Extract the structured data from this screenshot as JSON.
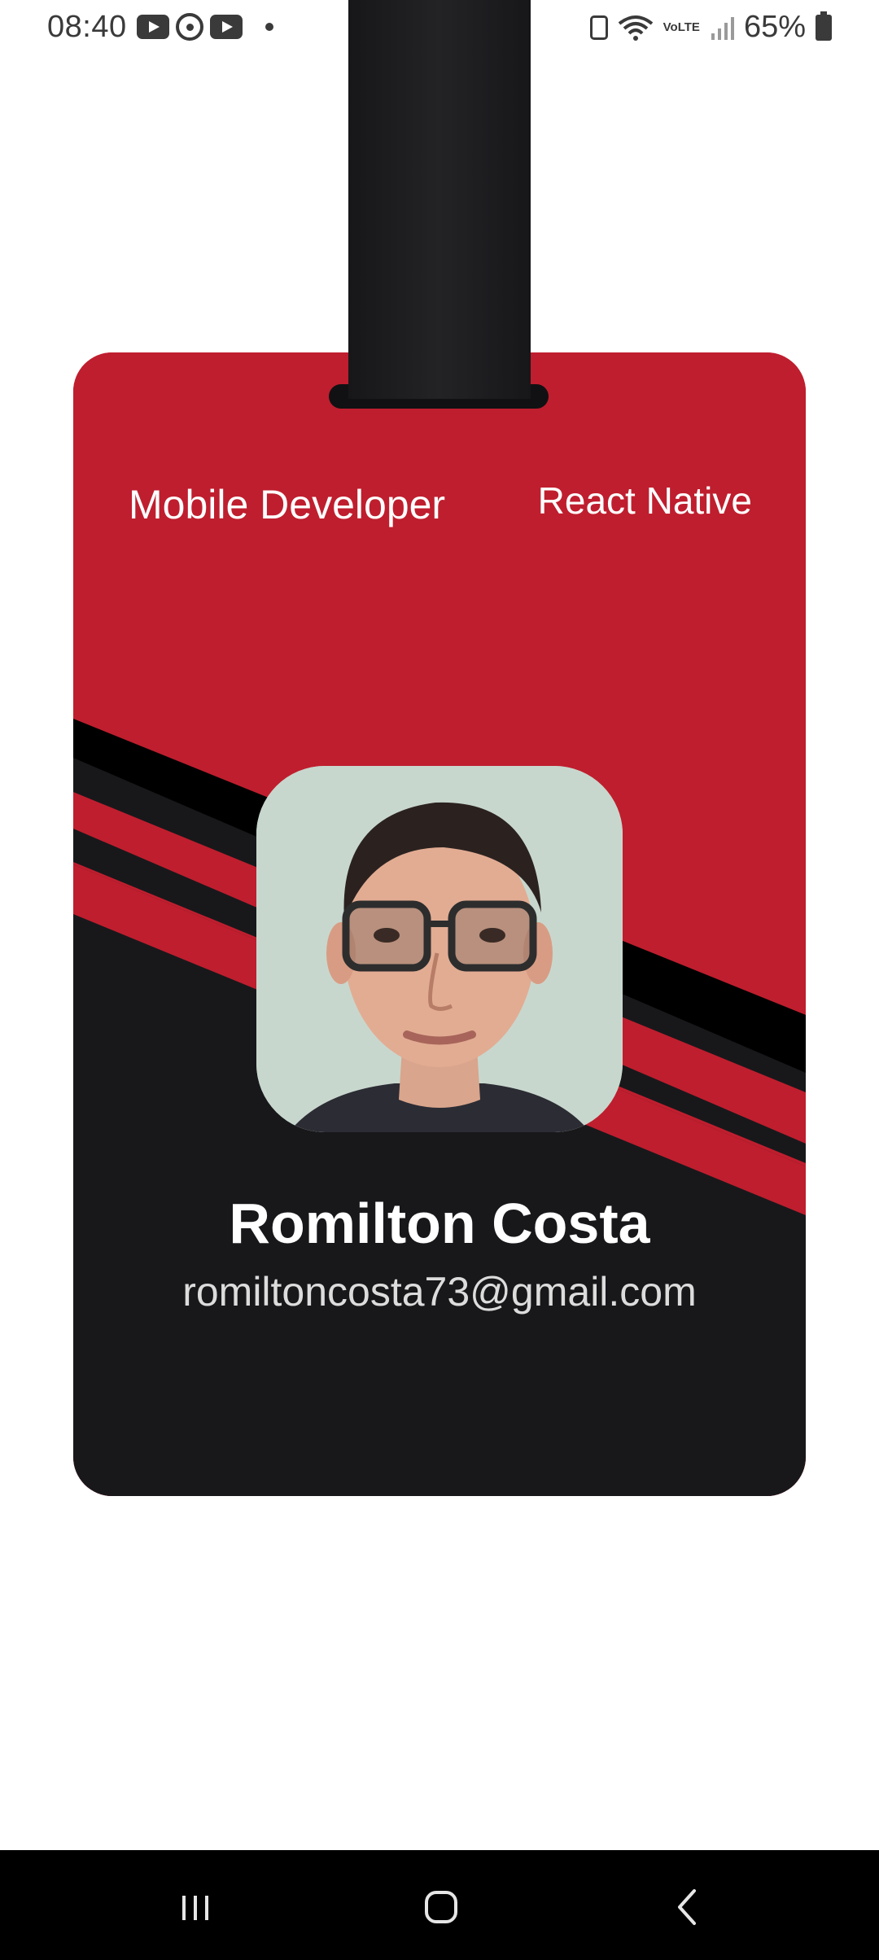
{
  "status_bar": {
    "time": "08:40",
    "battery": "65%",
    "network": "VoLTE",
    "notification_icons": [
      "youtube-icon",
      "whatsapp-icon",
      "youtube-icon",
      "dot-icon"
    ],
    "system_icons": [
      "nfc-icon",
      "wifi-icon",
      "volte-icon",
      "signal-icon",
      "battery-icon"
    ]
  },
  "badge": {
    "role": "Mobile Developer",
    "tech": "React Native",
    "name": "Romilton Costa",
    "email": "romiltoncosta73@gmail.com",
    "colors": {
      "primary": "#bf1e2e",
      "dark": "#18181b",
      "stripe": "#000000",
      "strap": "#1c1c1f"
    }
  },
  "nav_bar": {
    "buttons": [
      "recents-icon",
      "home-icon",
      "back-icon"
    ]
  }
}
